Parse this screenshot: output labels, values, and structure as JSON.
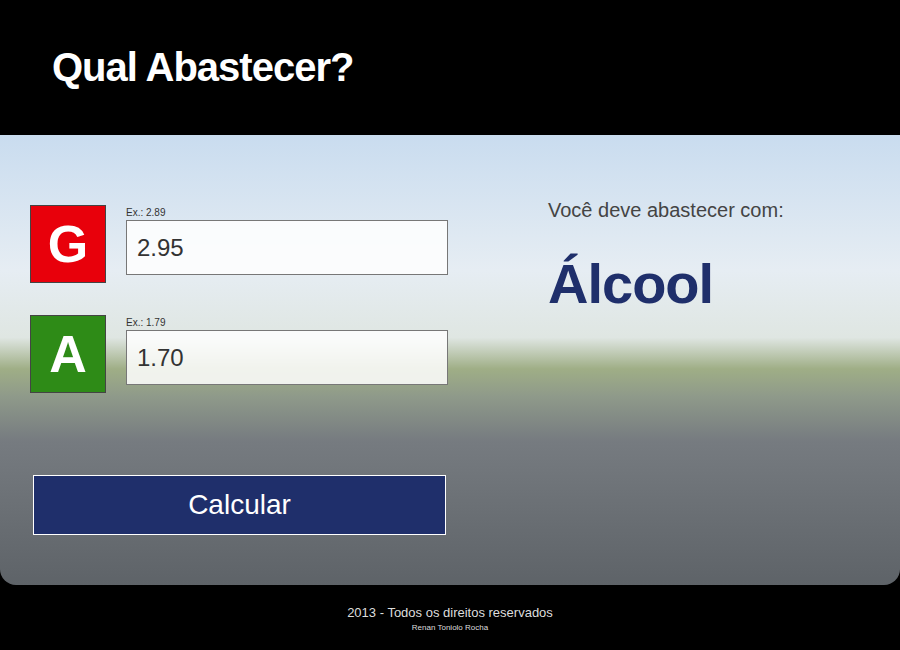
{
  "header": {
    "title": "Qual Abastecer?"
  },
  "fuels": [
    {
      "letter": "G",
      "example": "Ex.: 2.89",
      "value": "2.95",
      "color": "#e8000b"
    },
    {
      "letter": "A",
      "example": "Ex.: 1.79",
      "value": "1.70",
      "color": "#2e8b17"
    }
  ],
  "button": "Calcular",
  "result": {
    "label": "Você deve abastecer com:",
    "value": "Álcool"
  },
  "footer": {
    "copyright": "2013 - Todos os direitos reservados",
    "author": "Renan Toniolo Rocha"
  }
}
